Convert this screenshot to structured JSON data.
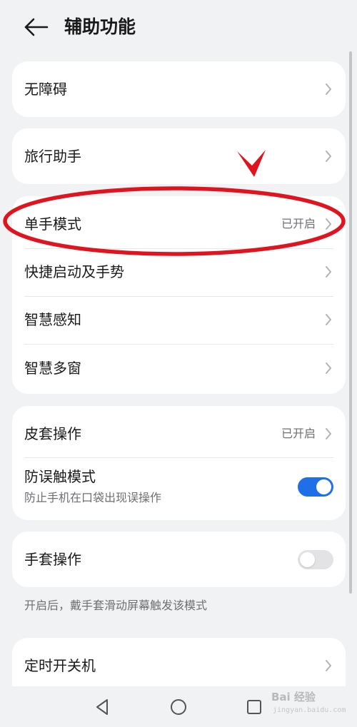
{
  "header": {
    "title": "辅助功能"
  },
  "groups": {
    "g1": {
      "items": [
        {
          "label": "无障碍"
        }
      ]
    },
    "g2": {
      "items": [
        {
          "label": "旅行助手"
        }
      ]
    },
    "g3": {
      "items": [
        {
          "label": "单手模式",
          "status": "已开启"
        },
        {
          "label": "快捷启动及手势"
        },
        {
          "label": "智慧感知"
        },
        {
          "label": "智慧多窗"
        }
      ]
    },
    "g4": {
      "items": [
        {
          "label": "皮套操作",
          "status": "已开启"
        },
        {
          "label": "防误触模式",
          "subtitle": "防止手机在口袋出现误操作",
          "toggle": true
        }
      ]
    },
    "g5": {
      "items": [
        {
          "label": "手套操作",
          "toggle": false
        }
      ]
    },
    "g5_note": "开启后，戴手套滑动屏幕触发该模式",
    "g6": {
      "items": [
        {
          "label": "定时开关机"
        }
      ]
    }
  },
  "colors": {
    "accent": "#1f6fe8",
    "annotation": "#e0141e",
    "background": "#f1f2f4"
  },
  "icons": {
    "back": "arrow-left-icon",
    "chevron": "chevron-right-icon",
    "nav_back": "triangle-back-icon",
    "nav_home": "circle-home-icon",
    "nav_recent": "square-recent-icon"
  },
  "watermark": {
    "brand": "Bai 经验",
    "url": "jingyan.baidu.com"
  }
}
